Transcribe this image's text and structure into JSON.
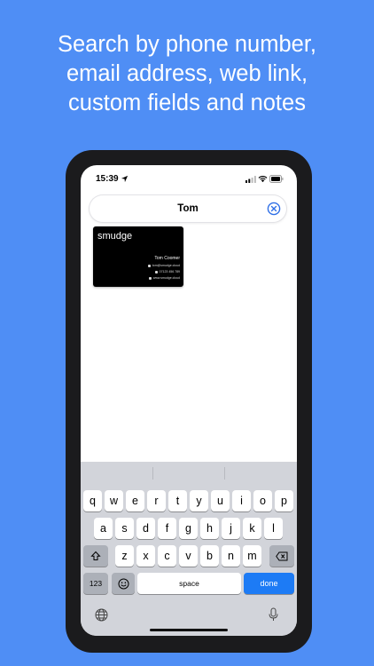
{
  "headline": {
    "lines": [
      "Search by phone number,",
      "email address, web link,",
      "custom fields and notes"
    ]
  },
  "status_bar": {
    "time": "15:39",
    "icons": [
      "location-arrow-icon",
      "cellular-signal-icon",
      "wifi-icon",
      "battery-icon"
    ]
  },
  "search": {
    "value": "Tom",
    "clear_icon": "clear-circle-icon"
  },
  "card": {
    "brand": "smudge",
    "name": "Tom Coomer",
    "email": "tom@smudge.cloud",
    "phone": "07123 456 789",
    "web": "www.smudge.cloud"
  },
  "keyboard": {
    "row1": [
      "q",
      "w",
      "e",
      "r",
      "t",
      "y",
      "u",
      "i",
      "o",
      "p"
    ],
    "row2": [
      "a",
      "s",
      "d",
      "f",
      "g",
      "h",
      "j",
      "k",
      "l"
    ],
    "row3": [
      "z",
      "x",
      "c",
      "v",
      "b",
      "n",
      "m"
    ],
    "numbers_label": "123",
    "space_label": "space",
    "done_label": "done",
    "accent_color": "#1d7bf5"
  },
  "colors": {
    "background": "#4f8ef5",
    "device": "#1b1b1d",
    "keyboard": "#d2d4da"
  }
}
